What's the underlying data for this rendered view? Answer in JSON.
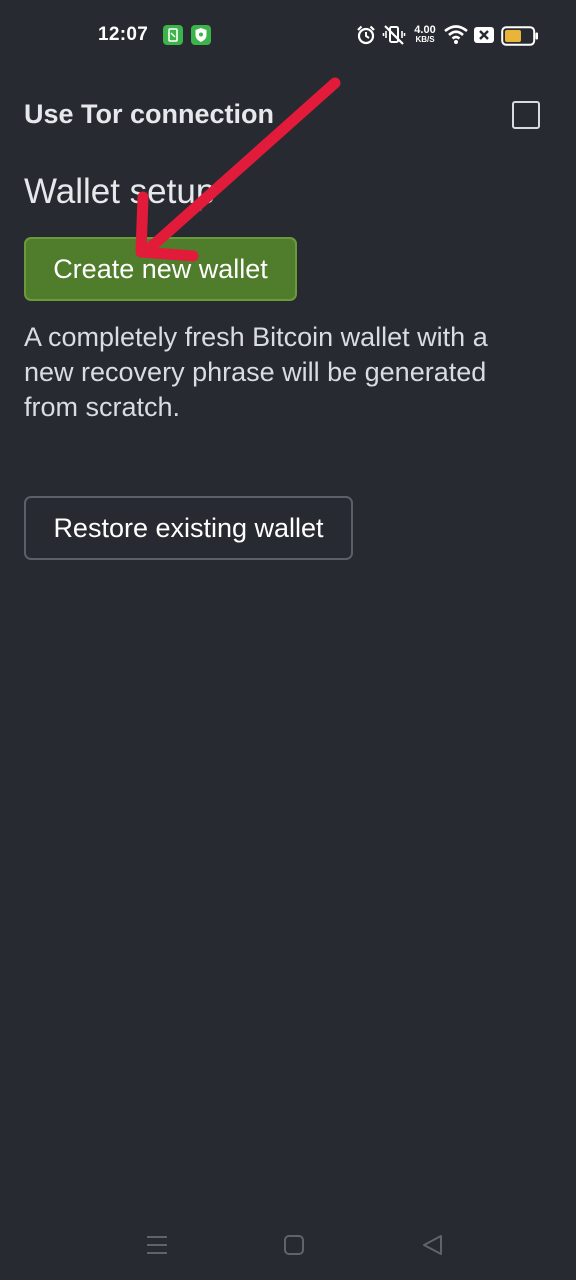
{
  "status_bar": {
    "time": "12:07",
    "net_speed_value": "4.00",
    "net_speed_unit": "KB/S",
    "battery_color": "#e8b53a",
    "icons": [
      "app-notification-icon",
      "shield-notification-icon",
      "alarm-icon",
      "vibrate-off-icon",
      "wifi-icon",
      "sim-off-icon",
      "battery-icon"
    ]
  },
  "settings": {
    "tor_label": "Use Tor connection",
    "tor_checked": false
  },
  "wallet_setup": {
    "title": "Wallet setup",
    "create_label": "Create new wallet",
    "create_description": "A completely fresh Bitcoin wallet with a new recovery phrase will be generated from scratch.",
    "restore_label": "Restore existing wallet"
  },
  "colors": {
    "background": "#272a30",
    "primary_button": "#4f7d2b",
    "annotation_arrow": "#e31b3a"
  },
  "nav_bar": {
    "icons": [
      "menu-icon",
      "home-icon",
      "back-icon"
    ]
  }
}
